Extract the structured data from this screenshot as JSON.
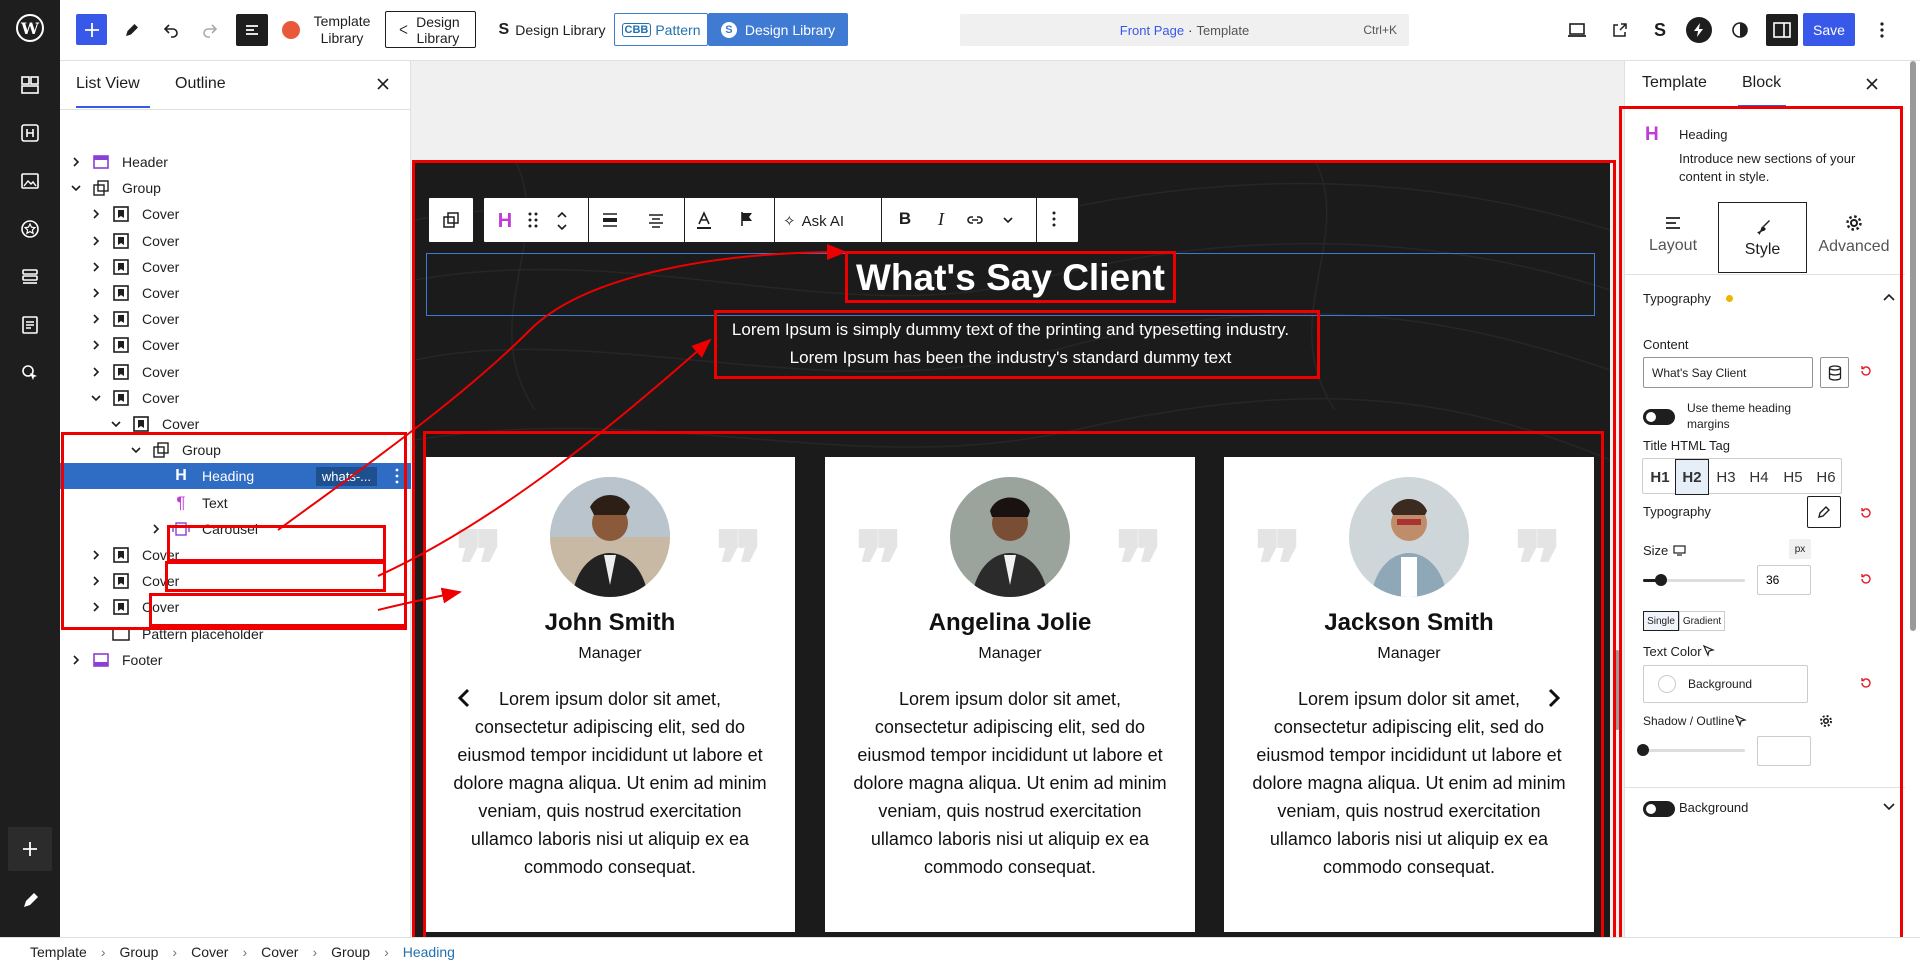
{
  "topbar": {
    "template_library": "Template Library",
    "design_library_outline": "Design Library",
    "design_library_s": "Design Library",
    "cbb_badge": "CBB",
    "pattern": "Pattern",
    "design_library_btn": "Design Library",
    "doc_title": "Front Page",
    "doc_sep": "·",
    "doc_type": "Template",
    "shortcut": "Ctrl+K",
    "save": "Save"
  },
  "listview": {
    "tab_list": "List View",
    "tab_outline": "Outline",
    "rows": [
      {
        "label": "Header"
      },
      {
        "label": "Group"
      },
      {
        "label": "Cover"
      },
      {
        "label": "Cover"
      },
      {
        "label": "Cover"
      },
      {
        "label": "Cover"
      },
      {
        "label": "Cover"
      },
      {
        "label": "Cover"
      },
      {
        "label": "Cover"
      },
      {
        "label": "Cover"
      },
      {
        "label": "Cover"
      },
      {
        "label": "Group"
      },
      {
        "label": "Heading",
        "extra": "whats-..."
      },
      {
        "label": "Text"
      },
      {
        "label": "Carousel"
      },
      {
        "label": "Cover"
      },
      {
        "label": "Cover"
      },
      {
        "label": "Cover"
      },
      {
        "label": "Pattern placeholder"
      },
      {
        "label": "Footer"
      }
    ]
  },
  "toolbar": {
    "ask_ai": "Ask AI"
  },
  "canvas": {
    "heading": "What's Say Client",
    "sub1": "Lorem Ipsum is simply dummy text of the printing and typesetting industry.",
    "sub2": "Lorem Ipsum has been the industry's standard dummy text",
    "cards": [
      {
        "name": "John Smith",
        "role": "Manager",
        "text": "Lorem ipsum dolor sit amet, consectetur adipiscing elit, sed do eiusmod tempor incididunt ut labore et dolore magna aliqua. Ut enim ad minim veniam, quis nostrud exercitation ullamco laboris nisi ut aliquip ex ea commodo consequat."
      },
      {
        "name": "Angelina Jolie",
        "role": "Manager",
        "text": "Lorem ipsum dolor sit amet, consectetur adipiscing elit, sed do eiusmod tempor incididunt ut labore et dolore magna aliqua. Ut enim ad minim veniam, quis nostrud exercitation ullamco laboris nisi ut aliquip ex ea commodo consequat."
      },
      {
        "name": "Jackson Smith",
        "role": "Manager",
        "text": "Lorem ipsum dolor sit amet, consectetur adipiscing elit, sed do eiusmod tempor incididunt ut labore et dolore magna aliqua. Ut enim ad minim veniam, quis nostrud exercitation ullamco laboris nisi ut aliquip ex ea commodo consequat."
      }
    ]
  },
  "panel": {
    "tab_template": "Template",
    "tab_block": "Block",
    "block_name": "Heading",
    "block_desc": "Introduce new sections of your content in style.",
    "subtab_layout": "Layout",
    "subtab_style": "Style",
    "subtab_advanced": "Advanced",
    "typography_section": "Typography",
    "content_label": "Content",
    "content_value": "What's Say Client",
    "theme_margins": "Use theme heading margins",
    "title_tag_label": "Title HTML Tag",
    "tags": [
      "H1",
      "H2",
      "H3",
      "H4",
      "H5",
      "H6"
    ],
    "selected_tag": "H2",
    "typography_label": "Typography",
    "size_label": "Size",
    "size_unit": "px",
    "size_value": "36",
    "single": "Single",
    "gradient": "Gradient",
    "text_color": "Text Color",
    "background_btn": "Background",
    "shadow_outline": "Shadow / Outline",
    "background_section": "Background"
  },
  "breadcrumbs": [
    "Template",
    "Group",
    "Cover",
    "Cover",
    "Group",
    "Heading"
  ],
  "colors": {
    "accent": "#3858e9",
    "save": "#3858e9",
    "selected": "#2271b1",
    "annotation": "#ee0000",
    "canvas_dark": "#1b1b1b"
  }
}
